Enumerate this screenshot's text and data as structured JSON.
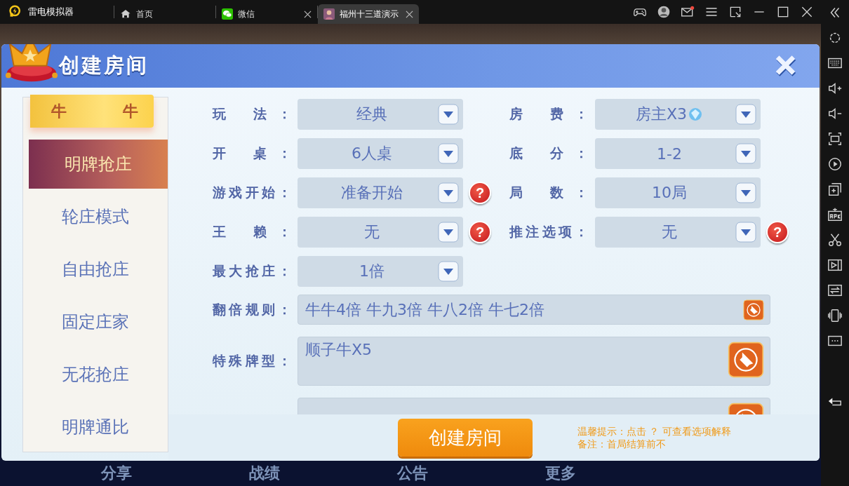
{
  "titlebar": {
    "app_name": "雷电模拟器",
    "tabs": [
      {
        "label": "首页",
        "kind": "home",
        "closable": false,
        "selected": false
      },
      {
        "label": "微信",
        "kind": "chat",
        "closable": true,
        "selected": false
      },
      {
        "label": "福州十三道演示",
        "kind": "game",
        "closable": true,
        "selected": true
      }
    ]
  },
  "dialog": {
    "title": "创建房间",
    "category": "牛 牛",
    "modes": [
      {
        "label": "明牌抢庄",
        "selected": true
      },
      {
        "label": "轮庄模式",
        "selected": false
      },
      {
        "label": "自由抢庄",
        "selected": false
      },
      {
        "label": "固定庄家",
        "selected": false
      },
      {
        "label": "无花抢庄",
        "selected": false
      },
      {
        "label": "明牌通比",
        "selected": false
      }
    ],
    "settings": [
      {
        "label": "玩 法：",
        "value": "经典",
        "diamond": false
      },
      {
        "label": "房 费：",
        "value": "房主X3",
        "diamond": true
      },
      {
        "label": "开 桌：",
        "value": "6人桌",
        "diamond": false
      },
      {
        "label": "底 分：",
        "value": "1-2",
        "diamond": false
      },
      {
        "label": "游戏开始：",
        "value": "准备开始",
        "diamond": false,
        "help": "?"
      },
      {
        "label": "局 数：",
        "value": "10局",
        "diamond": false
      },
      {
        "label": "王 赖：",
        "value": "无",
        "diamond": false,
        "help": "?"
      },
      {
        "label": "推注选项：",
        "value": "无",
        "diamond": false,
        "help": "?"
      },
      {
        "label": "最大抢庄：",
        "value": "1倍",
        "diamond": false
      }
    ],
    "rules": [
      {
        "kind": "line",
        "label": "翻倍规则：",
        "value": "牛牛4倍 牛九3倍 牛八2倍 牛七2倍"
      },
      {
        "kind": "box",
        "label": "特殊牌型：",
        "value": "顺子牛X5"
      },
      {
        "kind": "box"
      }
    ],
    "create_button": "创建房间",
    "tips": [
      "温馨提示：点击 ？ 可查看选项解释",
      "备注：首局结算前不"
    ]
  },
  "bottom_nav": [
    "分享",
    "战绩",
    "公告",
    "更多"
  ]
}
